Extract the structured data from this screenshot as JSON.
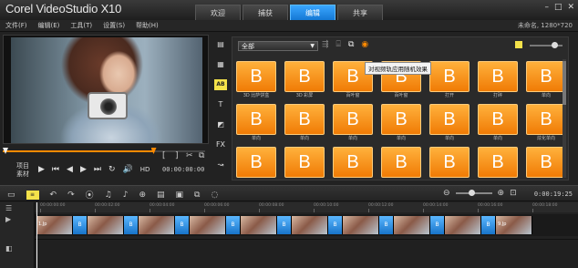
{
  "window": {
    "title": "Corel VideoStudio X10",
    "project": "未命名, 1280*720"
  },
  "tabs": [
    {
      "label": "欢迎",
      "active": false
    },
    {
      "label": "捕获",
      "active": false
    },
    {
      "label": "编辑",
      "active": true
    },
    {
      "label": "共享",
      "active": false
    }
  ],
  "menu": [
    "文件(F)",
    "编辑(E)",
    "工具(T)",
    "设置(S)",
    "帮助(H)"
  ],
  "player": {
    "modes": [
      "项目",
      "素材"
    ],
    "timecode": "00:00:00:00",
    "hd_label": "HD",
    "progress_fraction": 0.75
  },
  "library": {
    "filter_value": "全部",
    "tooltip": "对视频轨应用随机效果",
    "tile_glyph": "B",
    "transitions": [
      "3D 比萨饼盒",
      "3D 彩屏",
      "百叶窗",
      "百叶窗",
      "打开",
      "打碎",
      "单向",
      "单向",
      "单向",
      "单向",
      "单向",
      "单向",
      "单向",
      "炫化单向",
      "",
      "",
      "",
      "",
      "",
      "",
      ""
    ]
  },
  "timeline": {
    "time_display": "0:00:19:25",
    "ruler": [
      "00:00:00:00",
      "00:00:02:00",
      "00:00:04:00",
      "00:00:06:00",
      "00:00:08:00",
      "00:00:10:00",
      "00:00:12:00",
      "00:00:14:00",
      "00:00:16:00",
      "00:00:18:00"
    ],
    "clips": [
      "1.Jp",
      "",
      "",
      "",
      "",
      "",
      "",
      "",
      "",
      "9.Jp"
    ]
  },
  "colors": {
    "accent_blue": "#1e8ff0",
    "transition_orange": "#f7931e",
    "progress_orange": "#ff8a00"
  }
}
